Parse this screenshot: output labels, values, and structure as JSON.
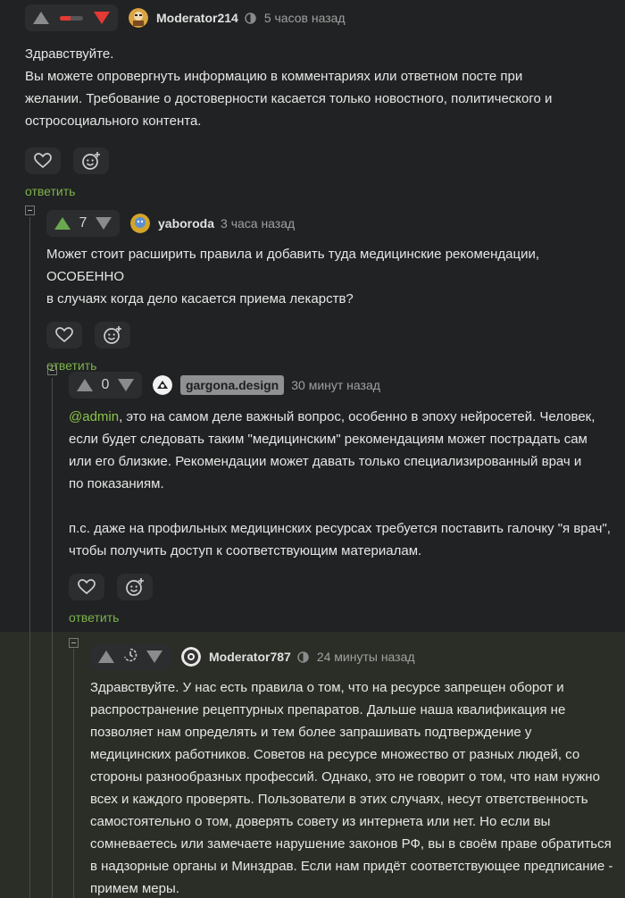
{
  "colors": {
    "background": "#212223",
    "highlight_background": "#2b2e26",
    "upvote_active": "#6aa84f",
    "downvote_active": "#e53935",
    "vote_inactive": "#8a8b8c",
    "reply_link": "#7bb34a"
  },
  "comments": [
    {
      "username": "Moderator214",
      "time": "5 часов назад",
      "rating_display": "ratio-bar",
      "rating_ratio_negative": 0.45,
      "vote_state": "downvoted",
      "moderator": true,
      "body": [
        "Здравствуйте.",
        "Вы можете опровергнуть информацию в комментариях или ответном посте при",
        "желании. Требование о достоверности касается только новостного, политического и",
        "остросоциального контента."
      ],
      "reply_label": "ответить",
      "icons": [
        "like-heart-icon",
        "add-reaction-icon"
      ]
    },
    {
      "username": "yaboroda",
      "time": "3 часа назад",
      "score": "7",
      "vote_state": "upvoted",
      "body": [
        "Может стоит расширить правила и добавить туда медицинские рекомендации, ОСОБЕННО",
        "в случаях когда дело касается приема лекарств?"
      ],
      "reply_label": "ответить"
    },
    {
      "username": "gargona.design",
      "time": "30 минут назад",
      "score": "0",
      "vote_state": "none",
      "mention": "@admin",
      "body_first_rest": ", это на самом деле важный вопрос, особенно в эпоху нейросетей. Человек,",
      "body": [
        "если будет следовать таким \"медицинским\" рекомендациям может пострадать сам",
        "или его близкие. Рекомендации может давать только специализированный врач и",
        "по показаниям.",
        "",
        "п.с. даже на профильных медицинских ресурсах требуется поставить галочку \"я врач\",",
        "чтобы получить доступ к соответствующим материалам."
      ],
      "reply_label": "ответить"
    },
    {
      "username": "Moderator787",
      "time": "24 минуты назад",
      "rating_display": "timer",
      "vote_state": "none",
      "moderator": true,
      "body": [
        "Здравствуйте. У нас есть правила о том, что на ресурсе запрещен оборот и",
        "распространение рецептурных препаратов. Дальше наша квалификация не",
        "позволяет нам определять и тем более запрашивать подтверждение у",
        "медицинских работников. Советов на ресурсе множество от разных людей, со",
        "стороны разнообразных профессий. Однако, это не говорит о том, что нам нужно",
        "всех и каждого проверять. Пользователи в этих случаях, несут ответственность",
        "самостоятельно о том, доверять совету из интернета или нет. Но если вы",
        "сомневаетесь или замечаете нарушение законов РФ, вы в своём праве обратиться",
        "в надзорные органы и Минздрав. Если нам придёт соответствующее предписание -",
        "примем меры."
      ]
    }
  ]
}
